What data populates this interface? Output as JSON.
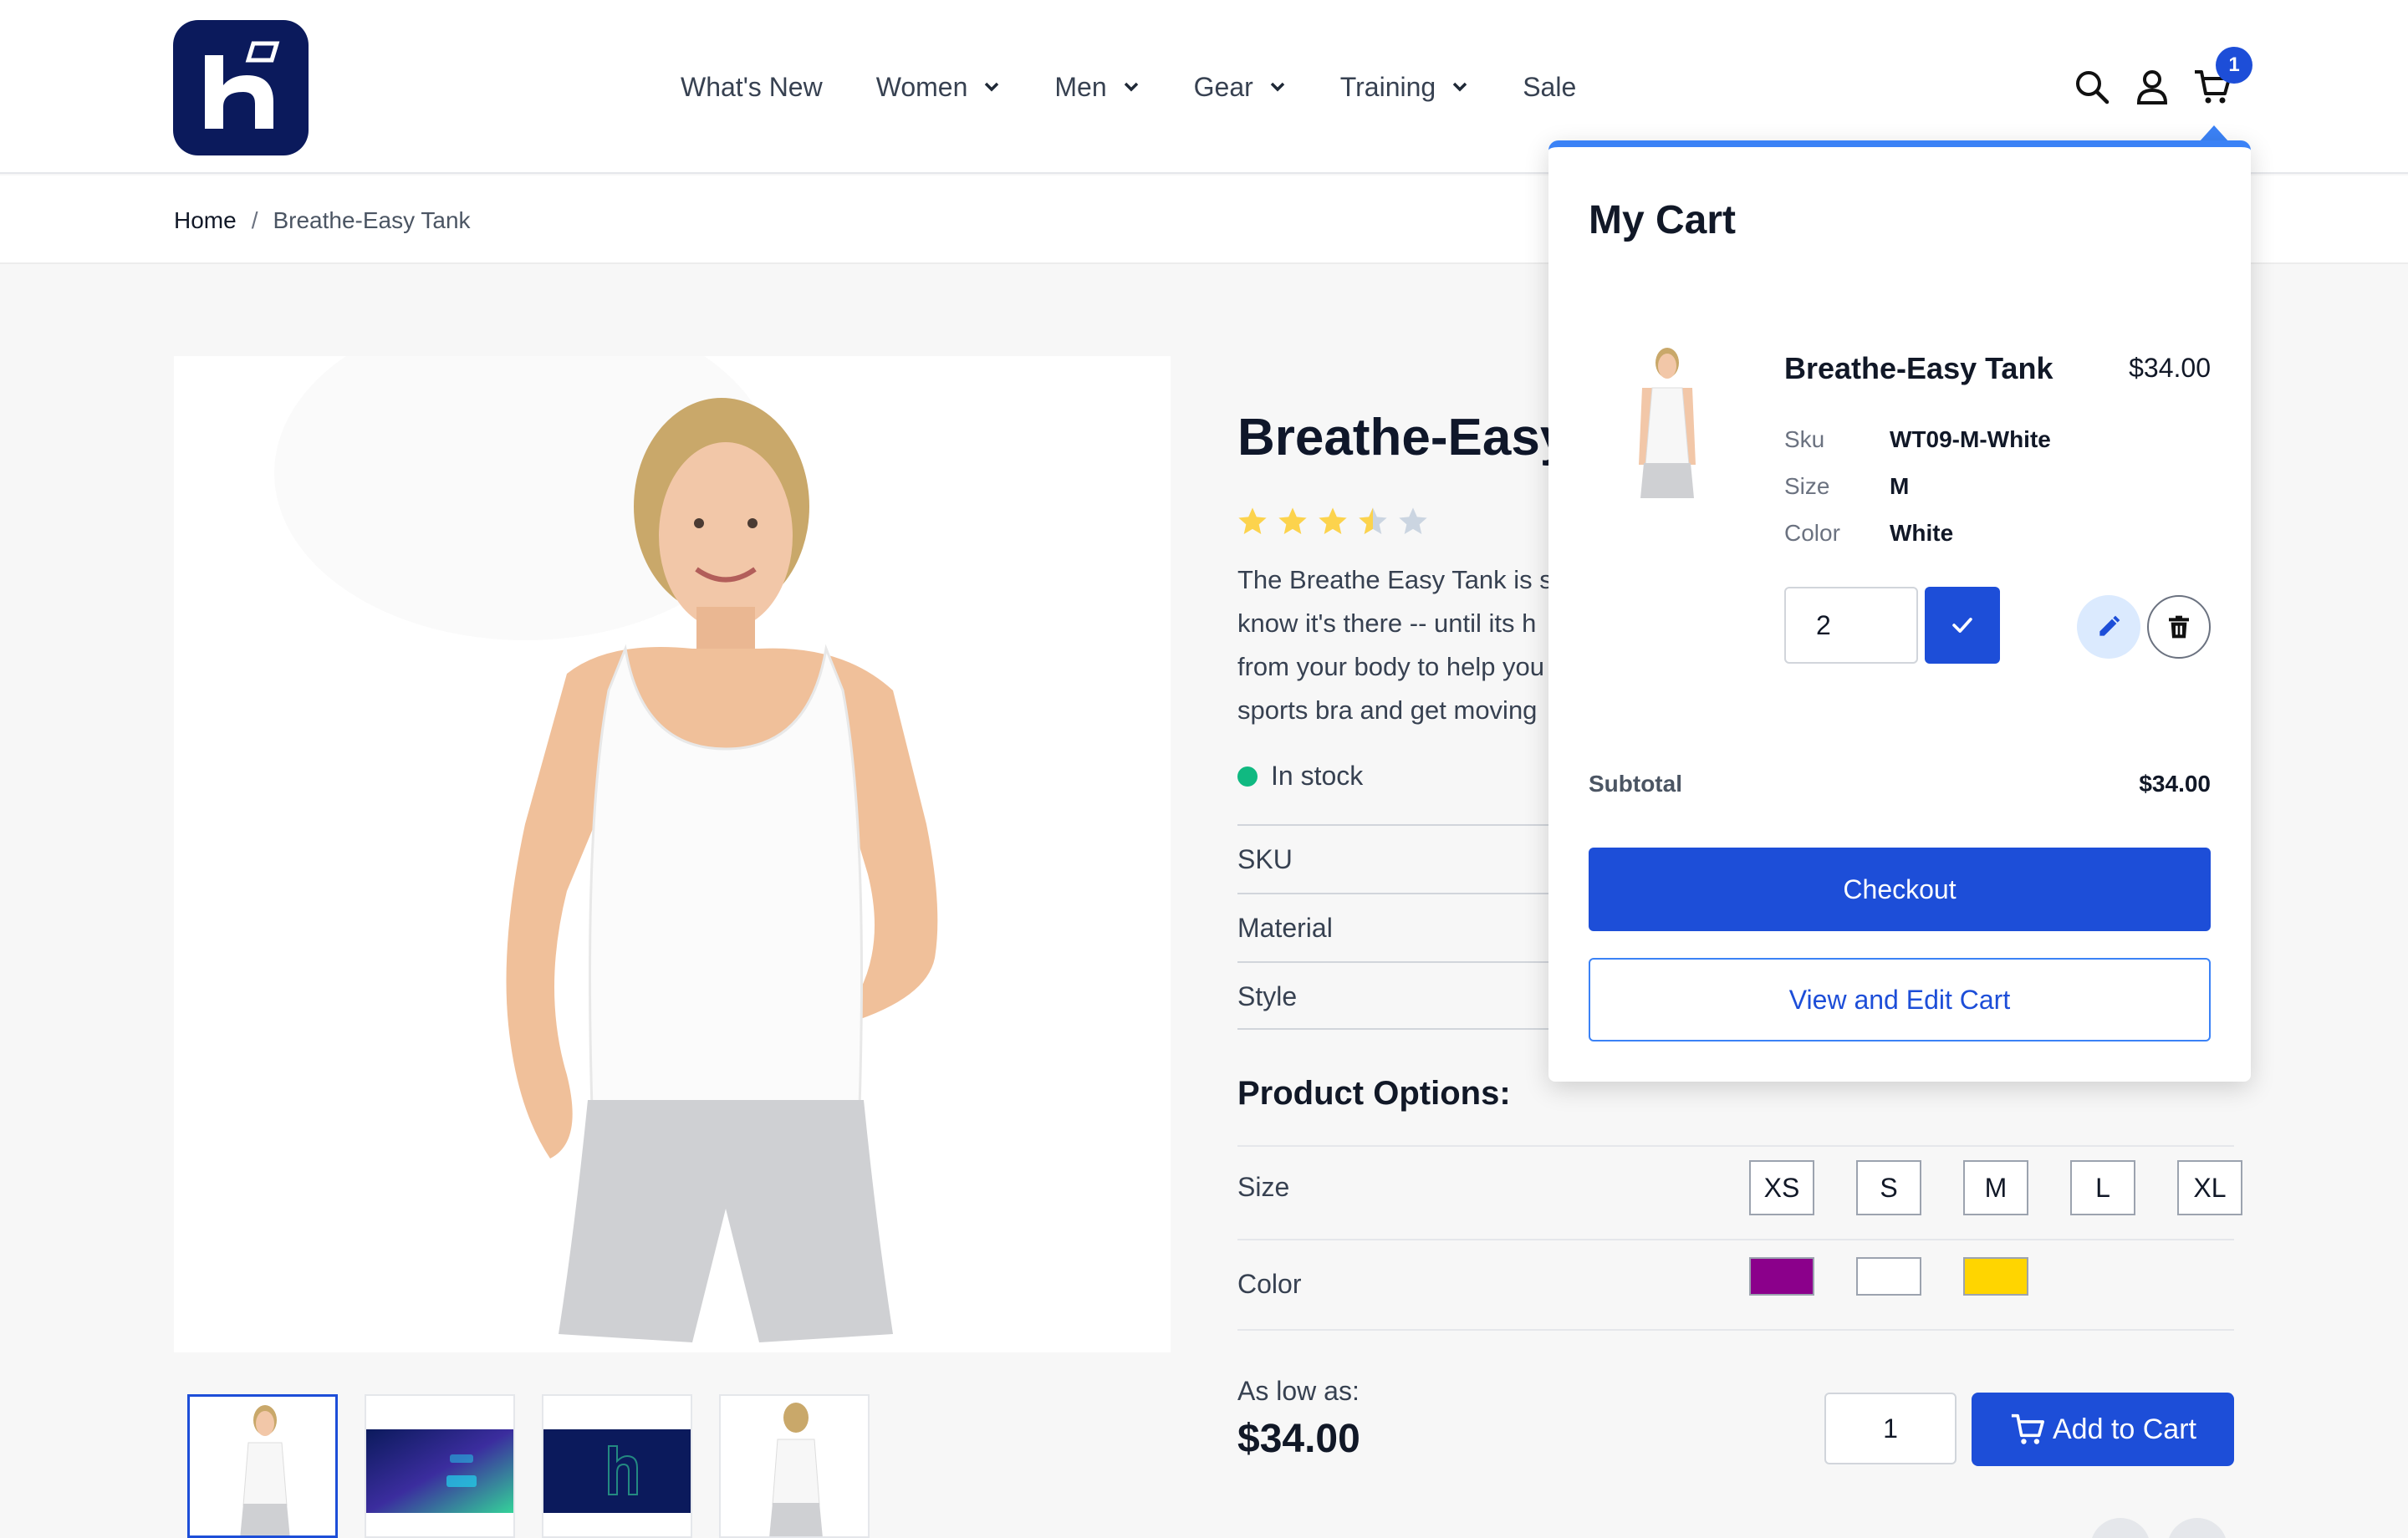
{
  "header": {
    "nav": [
      {
        "label": "What's New",
        "has_dropdown": false
      },
      {
        "label": "Women",
        "has_dropdown": true
      },
      {
        "label": "Men",
        "has_dropdown": true
      },
      {
        "label": "Gear",
        "has_dropdown": true
      },
      {
        "label": "Training",
        "has_dropdown": true
      },
      {
        "label": "Sale",
        "has_dropdown": false
      }
    ],
    "cart_count": "1",
    "icons": [
      "search-icon",
      "account-icon",
      "cart-icon"
    ]
  },
  "breadcrumb": {
    "home": "Home",
    "separator": "/",
    "current": "Breathe-Easy Tank"
  },
  "product": {
    "title": "Breathe-Easy Tank",
    "rating": 3.5,
    "rating_max": 5,
    "description_lines": [
      "The Breathe Easy Tank is s",
      "know it's there -- until its h",
      "from your body to help you",
      "sports bra and get moving"
    ],
    "stock": "In stock",
    "attributes": [
      "SKU",
      "Material",
      "Style"
    ],
    "options_title": "Product Options:",
    "size_label": "Size",
    "sizes": [
      "XS",
      "S",
      "M",
      "L",
      "XL"
    ],
    "color_label": "Color",
    "colors": [
      "#8b008b",
      "#ffffff",
      "#ffd500"
    ],
    "as_low_as": "As low as:",
    "price": "$34.00",
    "qty": "1",
    "add_to_cart": "Add to Cart"
  },
  "minicart": {
    "title": "My Cart",
    "item": {
      "name": "Breathe-Easy Tank",
      "price": "$34.00",
      "sku_label": "Sku",
      "sku": "WT09-M-White",
      "size_label": "Size",
      "size": "M",
      "color_label": "Color",
      "color": "White",
      "qty": "2"
    },
    "subtotal_label": "Subtotal",
    "subtotal": "$34.00",
    "checkout": "Checkout",
    "view_edit": "View and Edit Cart"
  },
  "colors": {
    "brand_navy": "#0b1a5c",
    "primary_blue": "#1d4ed8",
    "accent_blue": "#3b82f6",
    "in_stock_green": "#10b981",
    "star_yellow": "#fcd34d"
  }
}
